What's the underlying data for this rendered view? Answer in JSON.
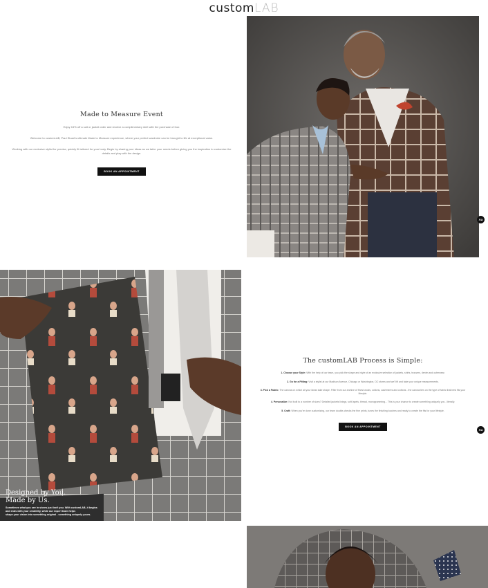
{
  "brand": {
    "logo_main": "custom",
    "logo_accent": "LAB"
  },
  "event": {
    "title": "Made to Measure Event",
    "line1": "Enjoy 15% off a suit or jacket order and receive a complimentary shirt with the purchase of four.",
    "line2": "Welcome to customLAB, Paul Stuart's ultimate Made to Measure experience, where your perfect wardrobe can be brought to life at exceptional value.",
    "line3": "Working with our exclusive stylist for precise, quickly fit tailored for your body. Begin by sharing your ideas as we tailor your needs before giving you the inspiration to customize the details and play with the design.",
    "cta": "BOOK AN APPOINTMENT"
  },
  "designed": {
    "heading1": "Designed by You.",
    "heading2": "Made by Us.",
    "body1": "Sometimes what you see in stores just isn't you. With customLAB, it begins",
    "body2": "and ends with your creativity, while our expert team helps",
    "body3": "shape your vision into something original - something uniquely yours."
  },
  "process": {
    "title": "The customLAB Process is Simple:",
    "steps": [
      {
        "label": "1. Choose your Style:",
        "text": "With the help of our team, you pick the shape and style of an exclusive selection of jackets, shirts, trousers, denim and outerwear."
      },
      {
        "label": "2. Go for a Fitting:",
        "text": "Visit a stylist at our Madison Avenue, Chicago or Washington, DC stores and we'll fit and take your unique measurements."
      },
      {
        "label": "3. Pick a Fabric:",
        "text": "The canvas on which all your ideas take shape. Filter from our archive of finest wools, cottons, cashmeres and cottons - the canvas ties on the type of fabric that best fits your lifestyle."
      },
      {
        "label": "4. Personalize:",
        "text": "Not built to a number of sizes? Detailed jackets linings, soft lapels, thread, monogramming... This is your chance to create something uniquely you - literally."
      },
      {
        "label": "5. Craft:",
        "text": "When you're done customizing, our team double-checks the fine prints, tunes the finishing touches and ready to create the fits for your lifestyle."
      }
    ],
    "cta": "BOOK AN APPOINTMENT"
  },
  "widget": {
    "aa_label": "Aa"
  },
  "colors": {
    "cta_bg": "#111111",
    "photo_bg": "#55524f",
    "tweed": "#5a3f33"
  }
}
